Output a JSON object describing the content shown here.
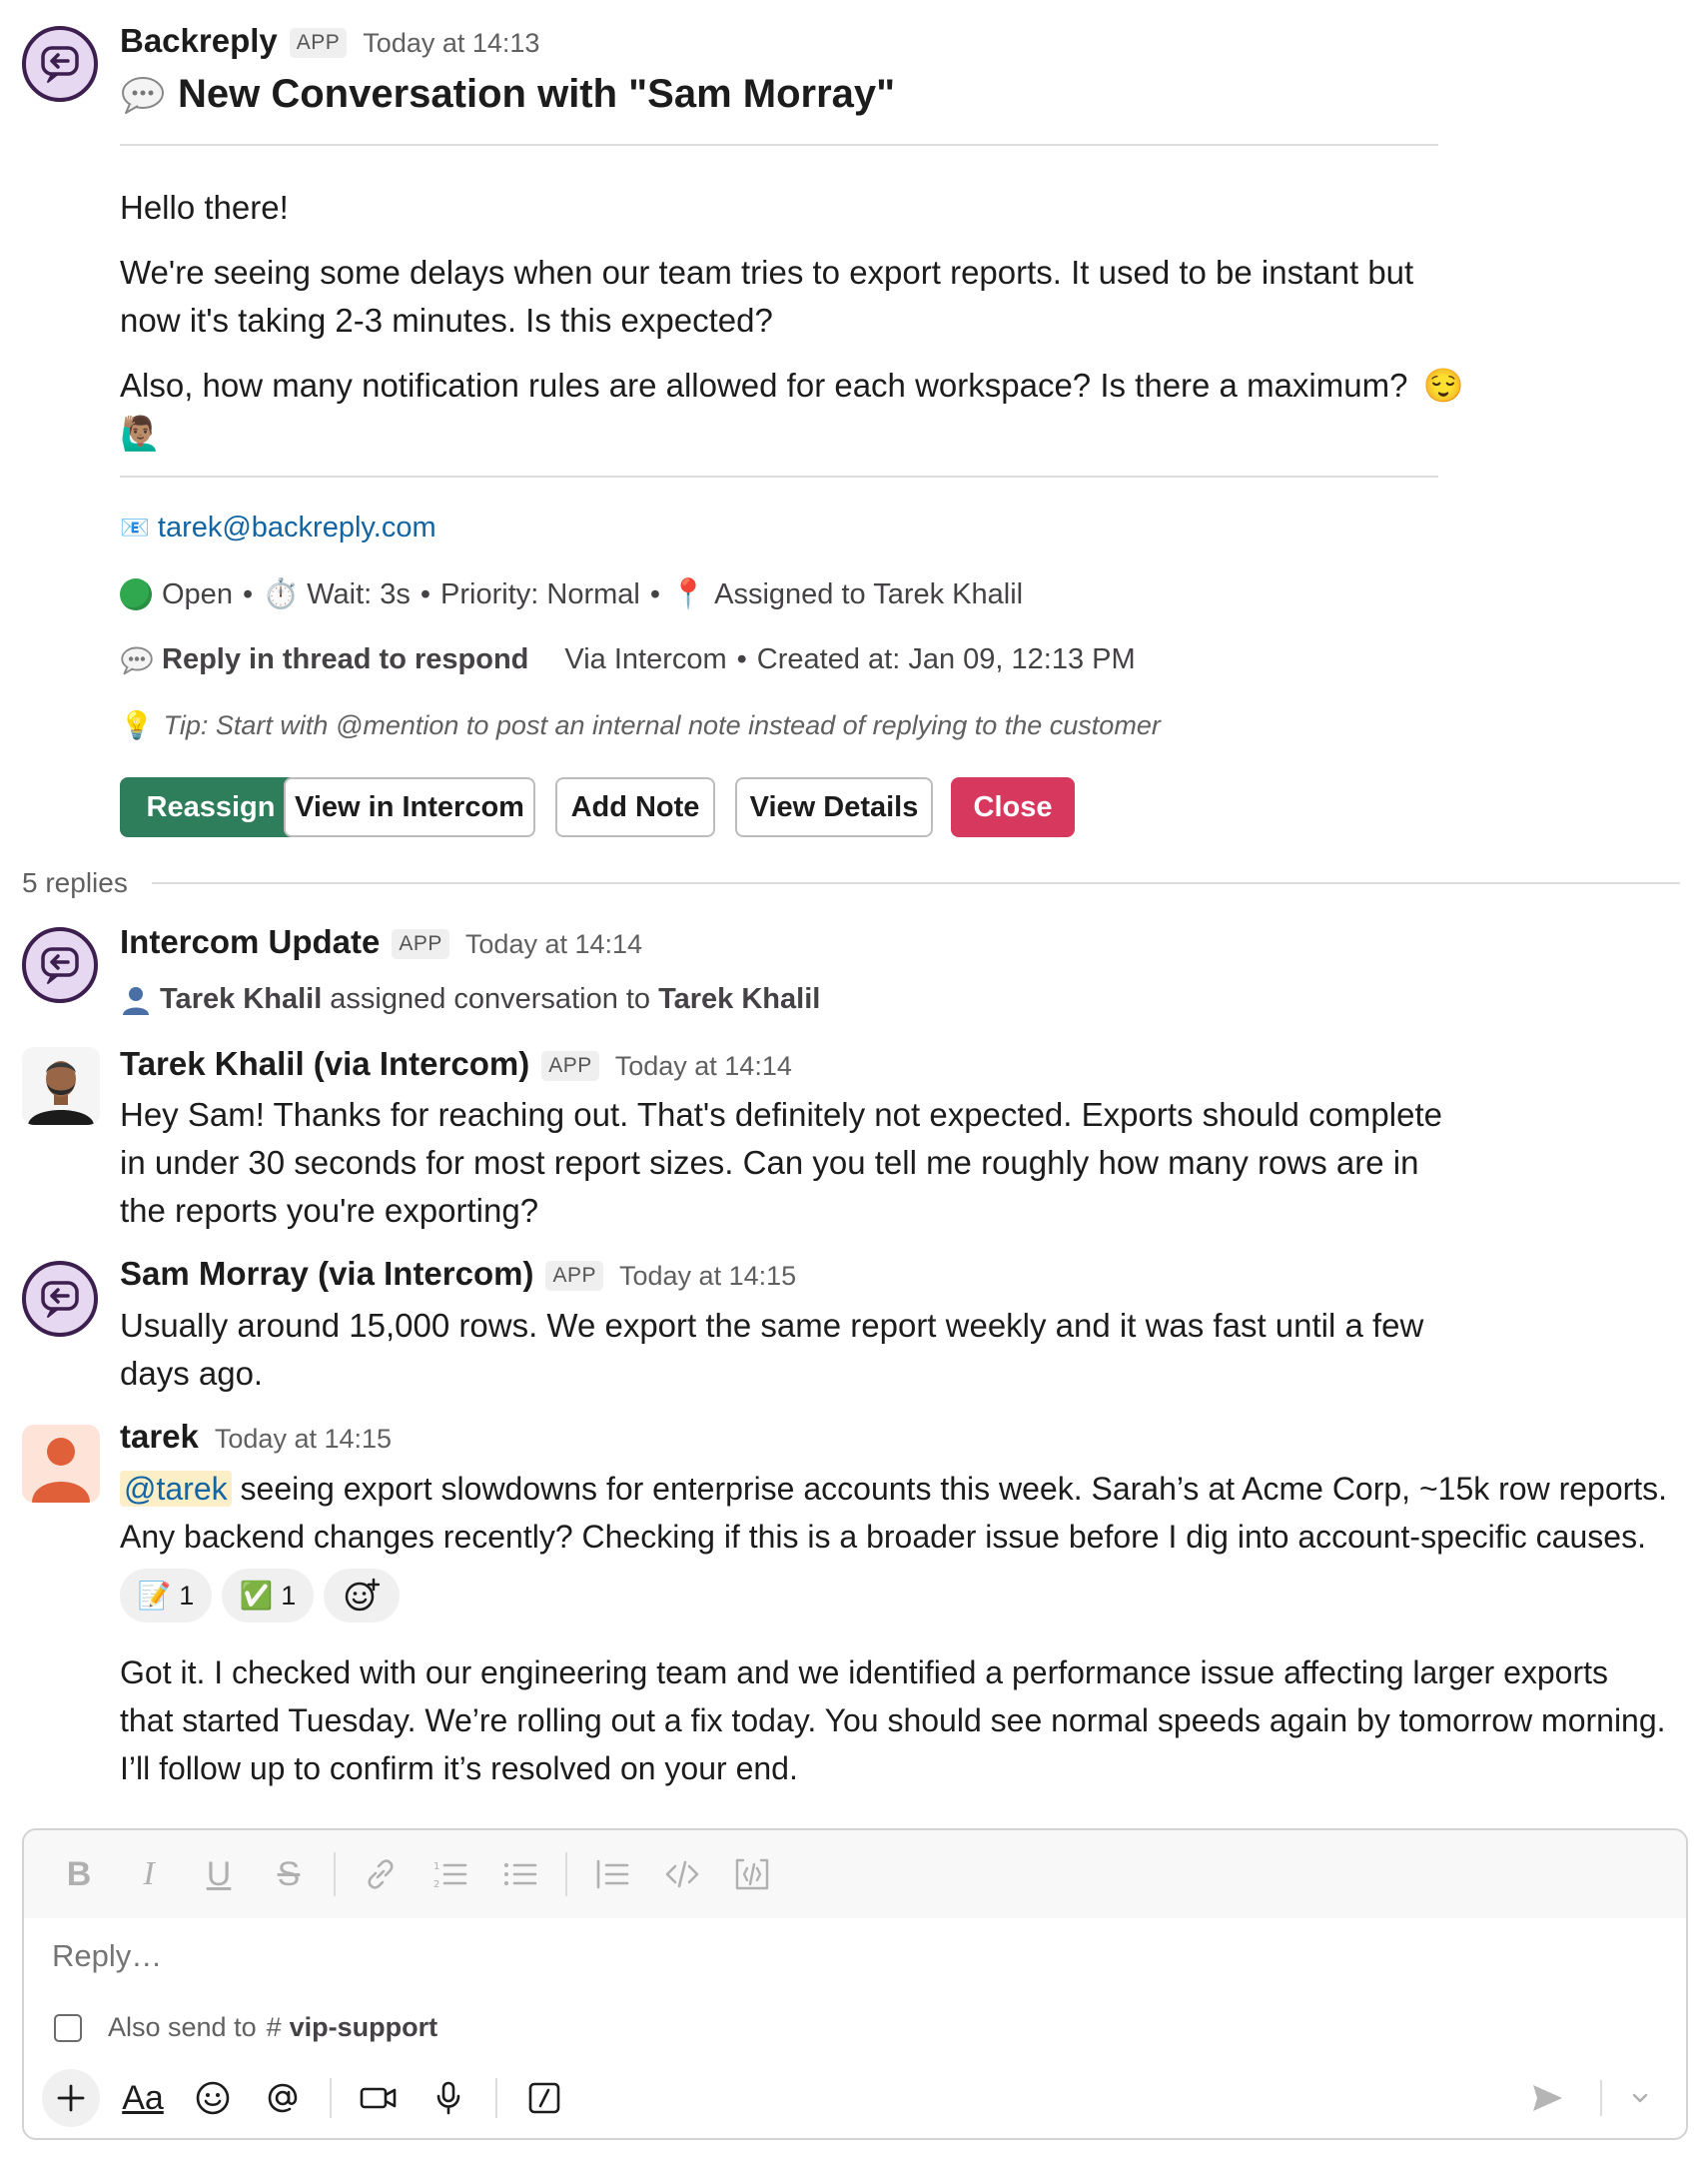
{
  "root_message": {
    "sender": "Backreply",
    "badge": "APP",
    "timestamp": "Today at 14:13",
    "title": "New Conversation with \"Sam Morray\"",
    "greeting": "Hello there!",
    "paragraph_1_line_1": "We're seeing some delays when our team tries to export reports. It used to be instant but",
    "paragraph_1_line_2": "now it's taking 2-3 minutes. Is this expected?",
    "paragraph_2": "Also, how many notification rules are allowed for each workspace? Is there a maximum?",
    "emoji_1": "😌",
    "emoji_2": "🙋🏽‍♂️",
    "email_icon": "📧",
    "email": "tarek@backreply.com",
    "status": "Open",
    "wait_icon": "⏱️",
    "wait": "Wait: 3s",
    "priority": "Priority: Normal",
    "pin_icon": "📍",
    "assigned": "Assigned to Tarek Khalil",
    "reply_hint": "Reply in thread to respond",
    "via": "Via Intercom",
    "created": "Created at: Jan 09, 12:13 PM",
    "tip_icon": "💡",
    "tip": "Tip: Start with @mention to post an internal note instead of replying to the customer",
    "buttons": {
      "reassign": "Reassign",
      "view_intercom": "View in Intercom",
      "add_note": "Add Note",
      "view_details": "View Details",
      "close": "Close"
    }
  },
  "thread": {
    "replies_count": "5 replies",
    "reply_1": {
      "sender": "Intercom Update",
      "badge": "APP",
      "timestamp": "Today at 14:14",
      "actor": "Tarek Khalil",
      "action": "assigned conversation to",
      "target": "Tarek Khalil"
    },
    "reply_2": {
      "sender": "Tarek Khalil (via Intercom)",
      "badge": "APP",
      "timestamp": "Today at 14:14",
      "line_1": "Hey Sam! Thanks for reaching out. That's definitely not expected. Exports should complete",
      "line_2": "in under 30 seconds for most report sizes. Can you tell me roughly how many rows are in",
      "line_3": "the reports you're exporting?"
    },
    "reply_3": {
      "sender": "Sam Morray (via Intercom)",
      "badge": "APP",
      "timestamp": "Today at 14:15",
      "line_1": "Usually around 15,000 rows. We export the same report weekly and it was fast until a few",
      "line_2": "days ago."
    },
    "reply_4": {
      "sender": "tarek",
      "timestamp": "Today at 14:15",
      "mention": "@tarek",
      "line_1_rest": " seeing export slowdowns for enterprise accounts this week. Sarah’s at Acme Corp, ~15k row reports.",
      "line_2": "Any backend changes recently? Checking if this is a broader issue before I dig into account-specific causes.",
      "reactions": [
        {
          "emoji": "📝",
          "count": "1"
        },
        {
          "emoji": "✅",
          "count": "1"
        }
      ]
    },
    "reply_5": {
      "line_1": "Got it. I checked with our engineering team and we identified a performance issue affecting larger exports",
      "line_2": "that started Tuesday. We’re rolling out a fix today. You should see normal speeds again by tomorrow morning.",
      "line_3": "I’ll follow up to confirm it’s resolved on your end."
    }
  },
  "composer": {
    "placeholder": "Reply…",
    "also_send_label": "Also send to",
    "channel_hash": "#",
    "channel": "vip-support",
    "format_label": "Aa",
    "bold": "B",
    "italic": "I",
    "underline": "U",
    "strike": "S"
  },
  "colors": {
    "accent_green": "#2e7d5b",
    "danger_red": "#d7385e",
    "link_blue": "#1264a3",
    "app_avatar_bg": "#e5d8f0",
    "app_avatar_ring": "#3d1f4f"
  }
}
